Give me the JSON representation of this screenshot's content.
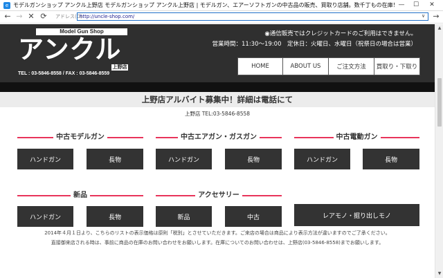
{
  "window": {
    "title": "モデルガンショップ アンクル上野店 モデルガンショップ アンクル上野店 | モデルガン、エアーソフトガンの中古品の販売、買取り店舗。数千丁もの在庫！",
    "app_icon": "e",
    "min_symbol": "—",
    "max_symbol": "☐",
    "close_symbol": "✕"
  },
  "addressbar": {
    "back_symbol": "←",
    "forward_symbol": "→",
    "stop_symbol": "✕",
    "refresh_symbol": "⟳",
    "label": "アドレス(D)",
    "url": "http://uncle-shop.com/",
    "dropdown_symbol": "∨",
    "go_symbol": "→"
  },
  "header": {
    "logo_top": "Model Gun Shop",
    "logo_main": "アンクル",
    "logo_branch": "上野店",
    "logo_tel": "TEL : 03-5846-8558 / FAX : 03-5846-8559",
    "note": "◉通信販売ではクレジットカードのご利用はできません。",
    "hours": "営業時間：11:30～19:00　定休日：火曜日、水曜日（祝祭日の場合は営業）"
  },
  "nav": [
    {
      "label": "HOME"
    },
    {
      "label": "ABOUT US"
    },
    {
      "label": "ご注文方法"
    },
    {
      "label": "買取り・下取り"
    }
  ],
  "notice": {
    "title": "上野店アルバイト募集中！詳細は電話にて",
    "tel": "上野店 TEL:03-5846-8558"
  },
  "categories": {
    "model_guns": {
      "title": "中古モデルガン",
      "buttons": [
        "ハンドガン",
        "長物"
      ]
    },
    "air_guns": {
      "title": "中古エアガン・ガスガン",
      "buttons": [
        "ハンドガン",
        "長物"
      ]
    },
    "electric_guns": {
      "title": "中古電動ガン",
      "buttons": [
        "ハンドガン",
        "長物"
      ]
    },
    "new_items": {
      "title": "新品",
      "buttons": [
        "ハンドガン",
        "長物"
      ]
    },
    "accessories": {
      "title": "アクセサリー",
      "buttons": [
        "新品",
        "中古"
      ]
    },
    "rare": {
      "button": "レアモノ・掘り出しモノ"
    }
  },
  "footer": {
    "line1": "2014年４月１日より、こちらのリストの表示価格は原則「税別」とさせていただきます。ご来店の場合は商品により表示方法が違いますのでご了承ください。",
    "line2": "直接御来店される時は、事前に商品の在庫のお問い合わせをお願いします。在庫についてのお問い合わせは、上野店(03-5846-8558)までお願いします。"
  },
  "colors": {
    "header_bg": "#2f2f2f",
    "accent_line": "#e8335a",
    "button_bg": "#333333",
    "link_blue": "#1e6fc8"
  },
  "icons": {
    "app": "ie-icon",
    "back": "back-arrow-icon",
    "forward": "forward-arrow-icon",
    "stop": "stop-icon",
    "refresh": "refresh-icon"
  }
}
